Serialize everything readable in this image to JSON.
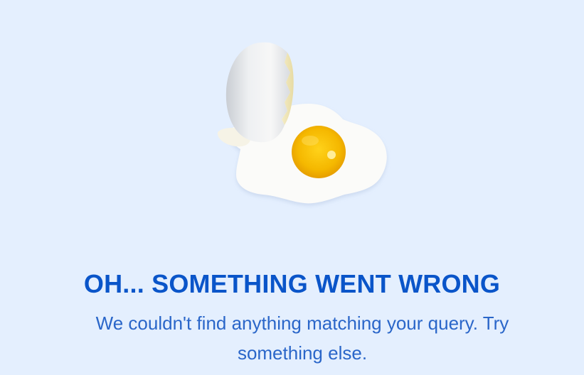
{
  "colors": {
    "background": "#e4effe",
    "title": "#0a55c9",
    "message": "#2a66c9",
    "egg_white": "#fbfbf9",
    "yolk": "#f2b400",
    "shell": "#e6e6e6"
  },
  "illustration": {
    "icon": "cracked-egg-icon"
  },
  "error": {
    "title": "OH... SOMETHING WENT WRONG",
    "message": "We couldn't find anything matching your query. Try something else."
  }
}
